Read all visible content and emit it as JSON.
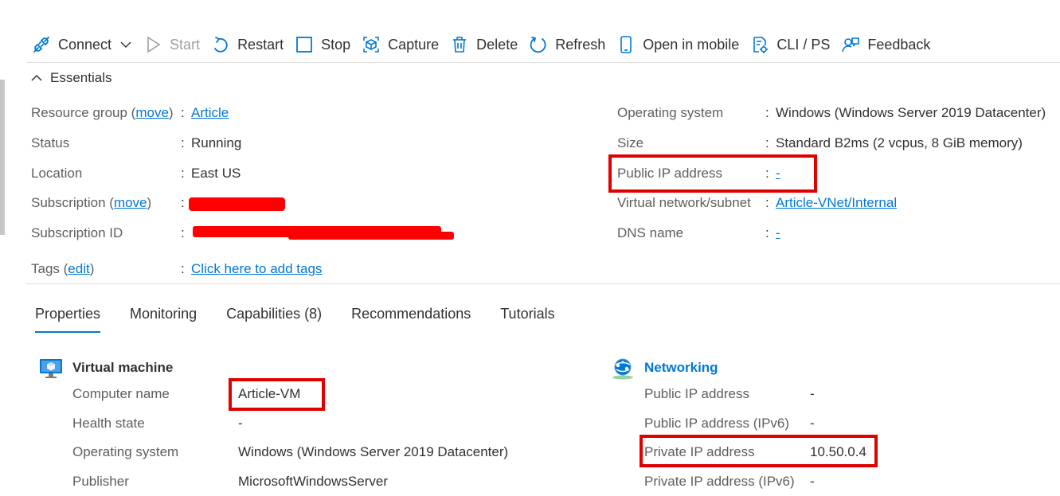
{
  "toolbar": {
    "connect": "Connect",
    "start": "Start",
    "restart": "Restart",
    "stop": "Stop",
    "capture": "Capture",
    "delete": "Delete",
    "refresh": "Refresh",
    "open_in_mobile": "Open in mobile",
    "cli_ps": "CLI / PS",
    "feedback": "Feedback"
  },
  "essentials": {
    "title": "Essentials",
    "left": {
      "resource_group_label": "Resource group (",
      "resource_group_move": "move",
      "resource_group_label_end": ")",
      "resource_group_value": "Article",
      "status_label": "Status",
      "status_value": "Running",
      "location_label": "Location",
      "location_value": "East US",
      "subscription_label": "Subscription (",
      "subscription_move": "move",
      "subscription_label_end": ")",
      "subscription_id_label": "Subscription ID",
      "tags_label": "Tags (",
      "tags_edit": "edit",
      "tags_label_end": ")",
      "tags_value": "Click here to add tags"
    },
    "right": {
      "os_label": "Operating system",
      "os_value": "Windows (Windows Server 2019 Datacenter)",
      "size_label": "Size",
      "size_value": "Standard B2ms (2 vcpus, 8 GiB memory)",
      "public_ip_label": "Public IP address",
      "public_ip_value": "-",
      "vnet_label": "Virtual network/subnet",
      "vnet_value": "Article-VNet/Internal",
      "dns_label": "DNS name",
      "dns_value": "-"
    },
    "separator": ":"
  },
  "tabs": [
    "Properties",
    "Monitoring",
    "Capabilities (8)",
    "Recommendations",
    "Tutorials"
  ],
  "virtual_machine": {
    "title": "Virtual machine",
    "rows": [
      {
        "label": "Computer name",
        "value": "Article-VM"
      },
      {
        "label": "Health state",
        "value": "-"
      },
      {
        "label": "Operating system",
        "value": "Windows (Windows Server 2019 Datacenter)"
      },
      {
        "label": "Publisher",
        "value": "MicrosoftWindowsServer"
      }
    ]
  },
  "networking": {
    "title": "Networking",
    "rows": [
      {
        "label": "Public IP address",
        "value": "-"
      },
      {
        "label": "Public IP address (IPv6)",
        "value": "-"
      },
      {
        "label": "Private IP address",
        "value": "10.50.0.4"
      },
      {
        "label": "Private IP address (IPv6)",
        "value": "-"
      }
    ]
  },
  "colors": {
    "accent": "#0078d4",
    "highlight": "#e00000",
    "redaction": "#ff0000"
  }
}
